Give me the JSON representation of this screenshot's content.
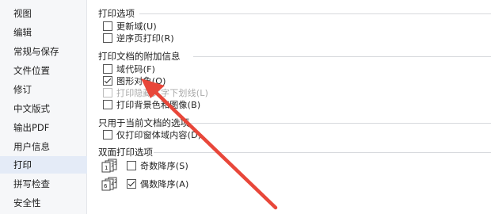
{
  "sidebar": {
    "items": [
      {
        "label": "视图",
        "active": false
      },
      {
        "label": "编辑",
        "active": false
      },
      {
        "label": "常规与保存",
        "active": false
      },
      {
        "label": "文件位置",
        "active": false
      },
      {
        "label": "修订",
        "active": false
      },
      {
        "label": "中文版式",
        "active": false
      },
      {
        "label": "输出PDF",
        "active": false
      },
      {
        "label": "用户信息",
        "active": false
      },
      {
        "label": "打印",
        "active": true
      },
      {
        "label": "拼写检查",
        "active": false
      },
      {
        "label": "安全性",
        "active": false
      }
    ]
  },
  "print_options": {
    "title": "打印选项",
    "update_fields": {
      "label": "更新域(U)",
      "checked": false
    },
    "reverse_order": {
      "label": "逆序页打印(R)",
      "checked": false
    }
  },
  "attached_info": {
    "title": "打印文档的附加信息",
    "field_codes": {
      "label": "域代码(F)",
      "checked": false
    },
    "drawing_objects": {
      "label": "图形对象(O)",
      "checked": true
    },
    "hidden_text": {
      "label": "打印隐藏文字下划线(L)",
      "checked": false,
      "disabled": true
    },
    "background": {
      "label": "打印背景色和图像(B)",
      "checked": false
    }
  },
  "current_doc": {
    "title": "只用于当前文档的选项",
    "form_data_only": {
      "label": "仅打印窗体域内容(D)",
      "checked": false
    }
  },
  "duplex": {
    "title": "双面打印选项",
    "odd_order": {
      "label": "奇数降序(S)",
      "checked": false,
      "icon_digits": "135"
    },
    "even_order": {
      "label": "偶数降序(A)",
      "checked": true,
      "icon_digits": "642"
    }
  },
  "annotation": {
    "color": "#e8473a"
  }
}
